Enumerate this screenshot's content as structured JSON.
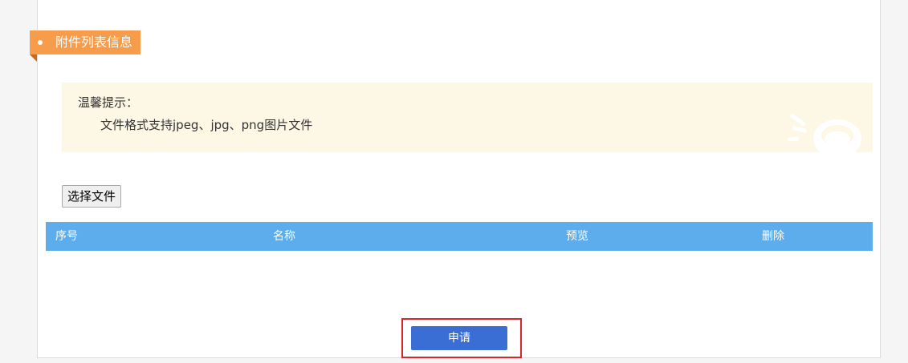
{
  "section": {
    "title": "附件列表信息",
    "accent_color": "#f79c4b"
  },
  "tip": {
    "title": "温馨提示：",
    "text": "文件格式支持jpeg、jpg、png图片文件",
    "background": "#fdf7e6",
    "decoration_icon": "hand-clap-illustration-icon"
  },
  "file_picker": {
    "label": "选择文件"
  },
  "table": {
    "header_color": "#5dadec",
    "columns": [
      "序号",
      "名称",
      "预览",
      "删除"
    ],
    "rows": []
  },
  "actions": {
    "apply_label": "申请",
    "apply_color": "#3b6ed5",
    "highlight_color": "#d9262c"
  }
}
